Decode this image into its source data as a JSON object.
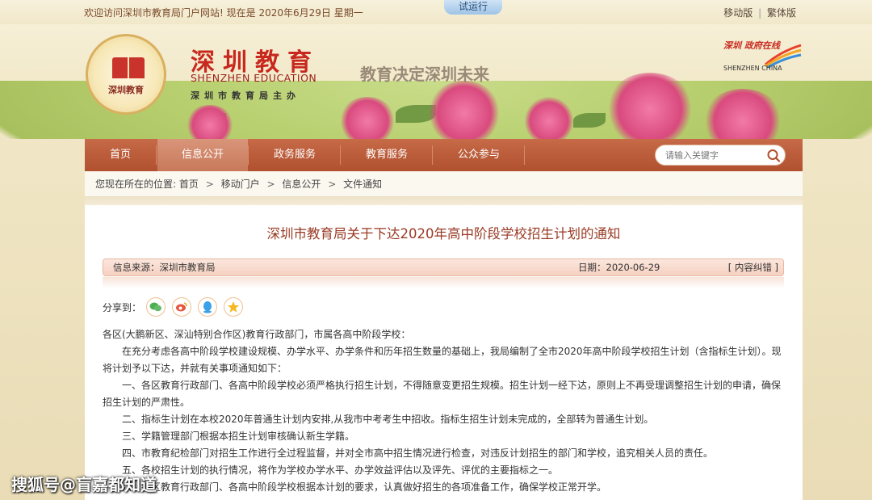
{
  "topbar": {
    "welcome": "欢迎访问深圳市教育局门户网站! 现在是 2020年6月29日 星期一",
    "trial": "试运行",
    "mobile": "移动版",
    "separator": "|",
    "traditional": "繁体版"
  },
  "header": {
    "seal_text": "深圳教育",
    "brand_cn": "深圳教育",
    "brand_en": "SHENZHEN EDUCATION",
    "brand_sub": "深圳市教育局主办",
    "slogan": "教育决定深圳未来",
    "sz_logo_cn": "深圳 政府在线",
    "sz_logo_en": "SHENZHEN CHINA"
  },
  "nav": {
    "items": [
      {
        "label": "首页"
      },
      {
        "label": "信息公开"
      },
      {
        "label": "政务服务"
      },
      {
        "label": "教育服务"
      },
      {
        "label": "公众参与"
      }
    ],
    "search_placeholder": "请输入关键字"
  },
  "breadcrumb": {
    "prefix": "您现在所在的位置:",
    "items": [
      "首页",
      "移动门户",
      "信息公开",
      "文件通知"
    ],
    "sep": ">"
  },
  "article": {
    "title": "深圳市教育局关于下达2020年高中阶段学校招生计划的通知",
    "source": "信息来源：深圳市教育局",
    "date": "日期：2020-06-29",
    "correct": "[ 内容纠错 ]",
    "share_label": "分享到：",
    "paragraphs": [
      "各区(大鹏新区、深汕特别合作区)教育行政部门，市属各高中阶段学校：",
      "在充分考虑各高中阶段学校建设规模、办学水平、办学条件和历年招生数量的基础上，我局编制了全市2020年高中阶段学校招生计划（含指标生计划）。现将计划予以下达，并就有关事项通知如下：",
      "一、各区教育行政部门、各高中阶段学校必须严格执行招生计划，不得随意变更招生规模。招生计划一经下达，原则上不再受理调整招生计划的申请，确保招生计划的严肃性。",
      "二、指标生计划在本校2020年普通生计划内安排,从我市中考考生中招收。指标生招生计划未完成的，全部转为普通生计划。",
      "三、学籍管理部门根据本招生计划审核确认新生学籍。",
      "四、市教育纪检部门对招生工作进行全过程监督，并对全市高中招生情况进行检查，对违反计划招生的部门和学校，追究相关人员的责任。",
      "五、各校招生计划的执行情况，将作为学校办学水平、办学效益评估以及评先、评优的主要指标之一。",
      "六、各区教育行政部门、各高中阶段学校根据本计划的要求，认真做好招生的各项准备工作，确保学校正常开学。"
    ]
  },
  "watermark": "搜狐号@盲嘉都知道",
  "colors": {
    "nav_bg": "#b0502e",
    "title": "#9a3a24",
    "brand_red": "#c8281e"
  }
}
